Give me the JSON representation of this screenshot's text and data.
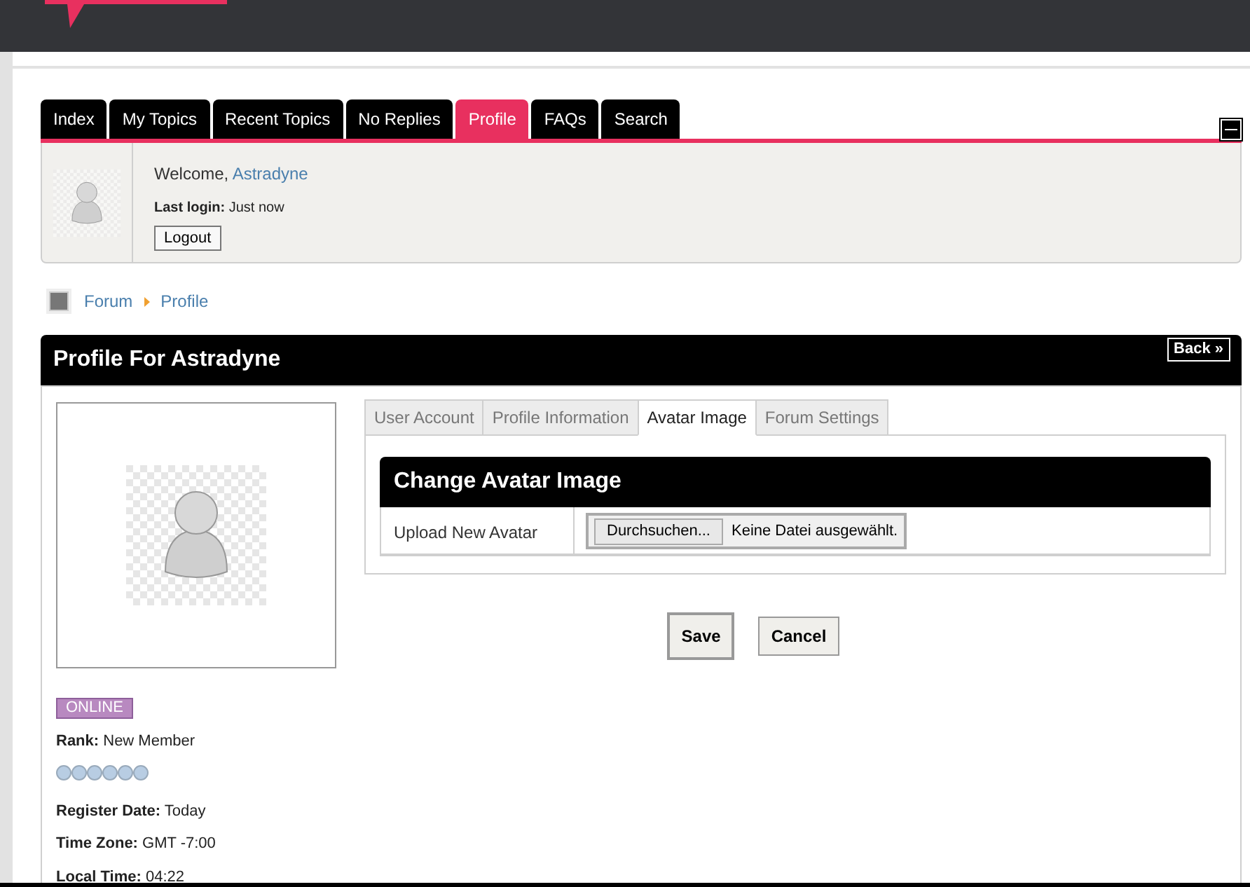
{
  "nav_tabs": [
    {
      "label": "Index",
      "selected": false
    },
    {
      "label": "My Topics",
      "selected": false
    },
    {
      "label": "Recent Topics",
      "selected": false
    },
    {
      "label": "No Replies",
      "selected": false
    },
    {
      "label": "Profile",
      "selected": true
    },
    {
      "label": "FAQs",
      "selected": false
    },
    {
      "label": "Search",
      "selected": false
    }
  ],
  "user_panel": {
    "welcome": "Welcome,",
    "username": "Astradyne",
    "last_login": "**Last login:** Just now",
    "logout": "Logout"
  },
  "breadcrumb": [
    "Forum",
    "Profile"
  ],
  "profile": {
    "title": "Profile For Astradyne",
    "back": "Back »",
    "status": "ONLINE",
    "details": [
      "**Rank:** New Member"
    ],
    "dates": [
      "**Register Date:** Today",
      "**Time Zone:** GMT -7:00",
      "**Local Time:** 04:22"
    ],
    "tabs": [
      {
        "label": "User Account",
        "selected": false
      },
      {
        "label": "Profile Information",
        "selected": false
      },
      {
        "label": "Avatar Image",
        "selected": true
      },
      {
        "label": "Forum Settings",
        "selected": false
      }
    ],
    "section_title": "Change Avatar Image",
    "upload_label": "Upload New Avatar",
    "browse_button": "Durchsuchen...",
    "file_status": "Keine Datei ausgewählt.",
    "buttons": [
      {
        "label": "Save",
        "kind": "primary"
      },
      {
        "label": "Cancel",
        "kind": "secondary"
      }
    ]
  }
}
